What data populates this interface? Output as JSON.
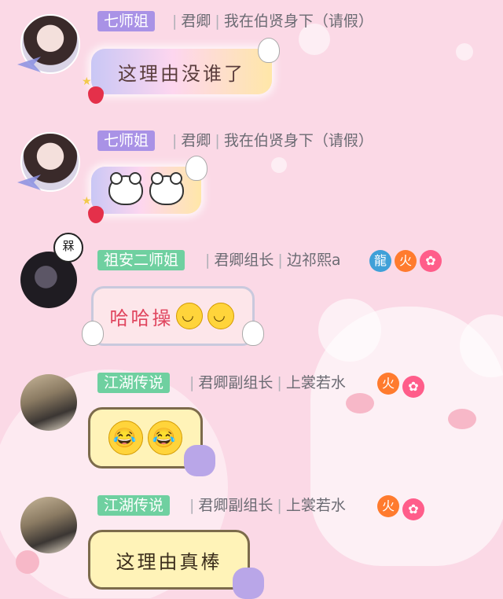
{
  "messages": [
    {
      "tag": "七师姐",
      "group": "君卿",
      "title": "我在伯贤身下（请假）",
      "text": "这理由没谁了"
    },
    {
      "tag": "七师姐",
      "group": "君卿",
      "title": "我在伯贤身下（请假）",
      "sticker": "bear-faces"
    },
    {
      "tag": "祖安二师姐",
      "group": "君卿组长",
      "title": "边祁熙a",
      "text": "哈哈操",
      "badge_seal": "槑"
    },
    {
      "tag": "江湖传说",
      "group": "君卿副组长",
      "title": "上裳若水",
      "sticker": "laughing-emojis"
    },
    {
      "tag": "江湖传说",
      "group": "君卿副组长",
      "title": "上裳若水",
      "text": "这理由真棒"
    }
  ],
  "separator": "|",
  "colors": {
    "tag_purple": "#a992e6",
    "tag_green": "#6fd0a0",
    "background": "#fbd9e6"
  }
}
